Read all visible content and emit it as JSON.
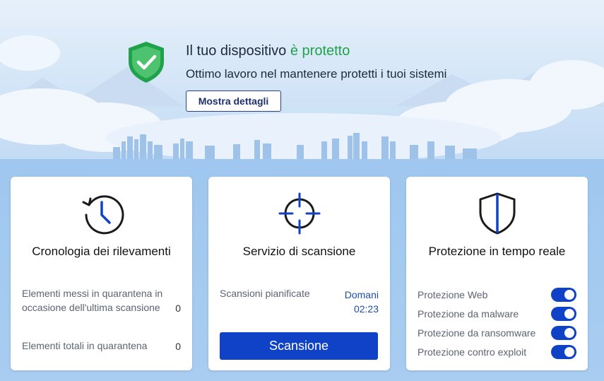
{
  "status": {
    "title_prefix": "Il tuo dispositivo ",
    "title_ok": "è protetto",
    "subtitle": "Ottimo lavoro nel mantenere protetti i tuoi sistemi",
    "details_button": "Mostra dettagli",
    "shield_icon": "shield-check-icon",
    "ok_color": "#1fa24a"
  },
  "history_card": {
    "icon": "clock-history-icon",
    "title": "Cronologia dei rilevamenti",
    "rows": [
      {
        "label": "Elementi messi in quarantena in occasione dell'ultima scansione",
        "value": "0"
      },
      {
        "label": "Elementi totali in quarantena",
        "value": "0"
      }
    ]
  },
  "scan_card": {
    "icon": "crosshair-icon",
    "title": "Servizio di scansione",
    "scheduled_label": "Scansioni pianificate",
    "scheduled_day": "Domani",
    "scheduled_time": "02:23",
    "scan_button": "Scansione",
    "accent_color": "#1042c7"
  },
  "protection_card": {
    "icon": "shield-outline-icon",
    "title": "Protezione in tempo reale",
    "items": [
      {
        "label": "Protezione Web",
        "enabled": true
      },
      {
        "label": "Protezione da malware",
        "enabled": true
      },
      {
        "label": "Protezione da ransomware",
        "enabled": true
      },
      {
        "label": "Protezione contro exploit",
        "enabled": true
      }
    ]
  }
}
